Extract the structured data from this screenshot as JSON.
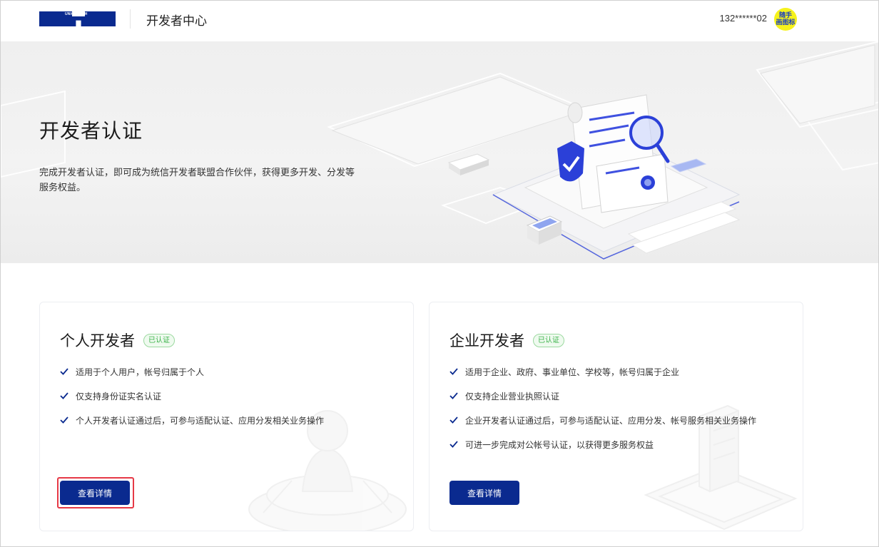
{
  "header": {
    "logo_text": "UNIONTECH",
    "title": "开发者中心",
    "user_phone": "132******02",
    "avatar_text": "随手\n画图标"
  },
  "banner": {
    "title": "开发者认证",
    "description": "完成开发者认证，即可成为统信开发者联盟合作伙伴，获得更多开发、分发等服务权益。"
  },
  "cards": [
    {
      "title": "个人开发者",
      "badge": "已认证",
      "features": [
        "适用于个人用户，帐号归属于个人",
        "仅支持身份证实名认证",
        "个人开发者认证通过后，可参与适配认证、应用分发相关业务操作"
      ],
      "button_label": "查看详情"
    },
    {
      "title": "企业开发者",
      "badge": "已认证",
      "features": [
        "适用于企业、政府、事业单位、学校等，帐号归属于企业",
        "仅支持企业营业执照认证",
        "企业开发者认证通过后，可参与适配认证、应用分发、帐号服务相关业务操作",
        "可进一步完成对公帐号认证，以获得更多服务权益"
      ],
      "button_label": "查看详情"
    }
  ],
  "colors": {
    "brand": "#0a2a8f",
    "badge_green": "#3bb34a",
    "avatar_bg": "#f6f21b",
    "highlight": "#e63946"
  }
}
